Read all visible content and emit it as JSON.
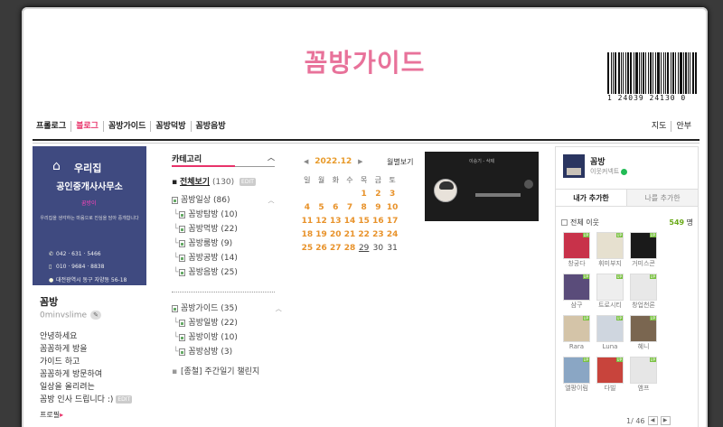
{
  "header": {
    "blog_title": "꼼방가이드",
    "barcode_number": "1  24039 24130  0"
  },
  "nav": {
    "left": [
      {
        "label": "프롤로그",
        "active": false
      },
      {
        "label": "블로그",
        "active": true
      },
      {
        "label": "꼼방가이드",
        "active": false
      },
      {
        "label": "꼼방덕방",
        "active": false
      },
      {
        "label": "꼼방음방",
        "active": false
      }
    ],
    "right": [
      {
        "label": "지도"
      },
      {
        "label": "안부"
      }
    ]
  },
  "profile": {
    "card_title_1": "우리집",
    "card_title_2": "공인중개사사무소",
    "card_mascot": "꿈방이",
    "card_desc": "우리집을 생각하는 마음으로 진심을 담아 중개합니다",
    "card_phone": "042 · 631 · 5466",
    "card_mobile": "010 · 9684 · 8838",
    "card_address": "대전광역시 동구 자양동 56-18",
    "nickname": "꼼방",
    "handle": "0minvslime",
    "intro_lines": [
      "안녕하세요",
      "꼼꼼하게 방을",
      "가이드 하고",
      "꼼꼼하게 방문하여",
      "일상을 올리려는",
      "꼼방 인사 드립니다 :)"
    ],
    "edit_badge": "EDIT",
    "neighbor_link": "프로필"
  },
  "category": {
    "header": "카테고리",
    "all_label": "전체보기",
    "all_count": "(130)",
    "edit_badge": "EDIT",
    "groups": [
      {
        "name": "꼼방일상",
        "count": "(86)",
        "children": [
          {
            "name": "꼼방탐방",
            "count": "(10)"
          },
          {
            "name": "꼼방먹방",
            "count": "(22)"
          },
          {
            "name": "꼼방룸방",
            "count": "(9)"
          },
          {
            "name": "꼼방공방",
            "count": "(14)"
          },
          {
            "name": "꼼방음방",
            "count": "(25)"
          }
        ]
      },
      {
        "name": "꼼방가이드",
        "count": "(35)",
        "children": [
          {
            "name": "꼼방일방",
            "count": "(22)"
          },
          {
            "name": "꼼방이방",
            "count": "(10)"
          },
          {
            "name": "꼼방삼방",
            "count": "(3)"
          }
        ]
      }
    ],
    "extra": "[종철] 주간일기 챌린지"
  },
  "calendar": {
    "month_label": "2022.12",
    "weekly_label": "월별보기",
    "dow": [
      "일",
      "월",
      "화",
      "수",
      "목",
      "금",
      "토"
    ],
    "weeks": [
      [
        "",
        "",
        "",
        "",
        "1",
        "2",
        "3"
      ],
      [
        "4",
        "5",
        "6",
        "7",
        "8",
        "9",
        "10"
      ],
      [
        "11",
        "12",
        "13",
        "14",
        "15",
        "16",
        "17"
      ],
      [
        "18",
        "19",
        "20",
        "21",
        "22",
        "23",
        "24"
      ],
      [
        "25",
        "26",
        "27",
        "28",
        "29",
        "30",
        "31"
      ]
    ],
    "post_days": [
      "1",
      "2",
      "3",
      "4",
      "5",
      "6",
      "7",
      "8",
      "9",
      "10",
      "11",
      "12",
      "13",
      "14",
      "15",
      "16",
      "17",
      "18",
      "19",
      "20",
      "21",
      "22",
      "23",
      "24",
      "25",
      "26",
      "27",
      "28"
    ],
    "today": "29"
  },
  "video": {
    "title": "이승기 - 삭제"
  },
  "neighbors": {
    "name": "꼼방",
    "sub": "이웃커넥트",
    "tab_mine": "내가 추가한",
    "tab_others": "나를 추가한",
    "all_label": "전체 이웃",
    "count": "549",
    "count_unit": "명",
    "items": [
      {
        "label": "창궁다",
        "color": "#c8324a"
      },
      {
        "label": "휘미부지",
        "color": "#e6e0cf"
      },
      {
        "label": "거미스콘",
        "color": "#1a1a1a"
      },
      {
        "label": "",
        "color": "#ffffff"
      },
      {
        "label": "삼구",
        "color": "#5a4c7a"
      },
      {
        "label": "트로시티",
        "color": "#eeeeee"
      },
      {
        "label": "창업천론",
        "color": "#e8e8e8"
      },
      {
        "label": "",
        "color": "#ffffff"
      },
      {
        "label": "Rara",
        "color": "#d4c4a8"
      },
      {
        "label": "Luna",
        "color": "#cfd6df"
      },
      {
        "label": "혜니",
        "color": "#7a6650"
      },
      {
        "label": "",
        "color": "#ffffff"
      },
      {
        "label": "엘팡이림",
        "color": "#8aa6c4"
      },
      {
        "label": "다빌",
        "color": "#c8443c"
      },
      {
        "label": "앰프",
        "color": "#e6e6e6"
      },
      {
        "label": "",
        "color": "#ffffff"
      }
    ],
    "page": "1/ 46",
    "up_badge": "UP"
  }
}
